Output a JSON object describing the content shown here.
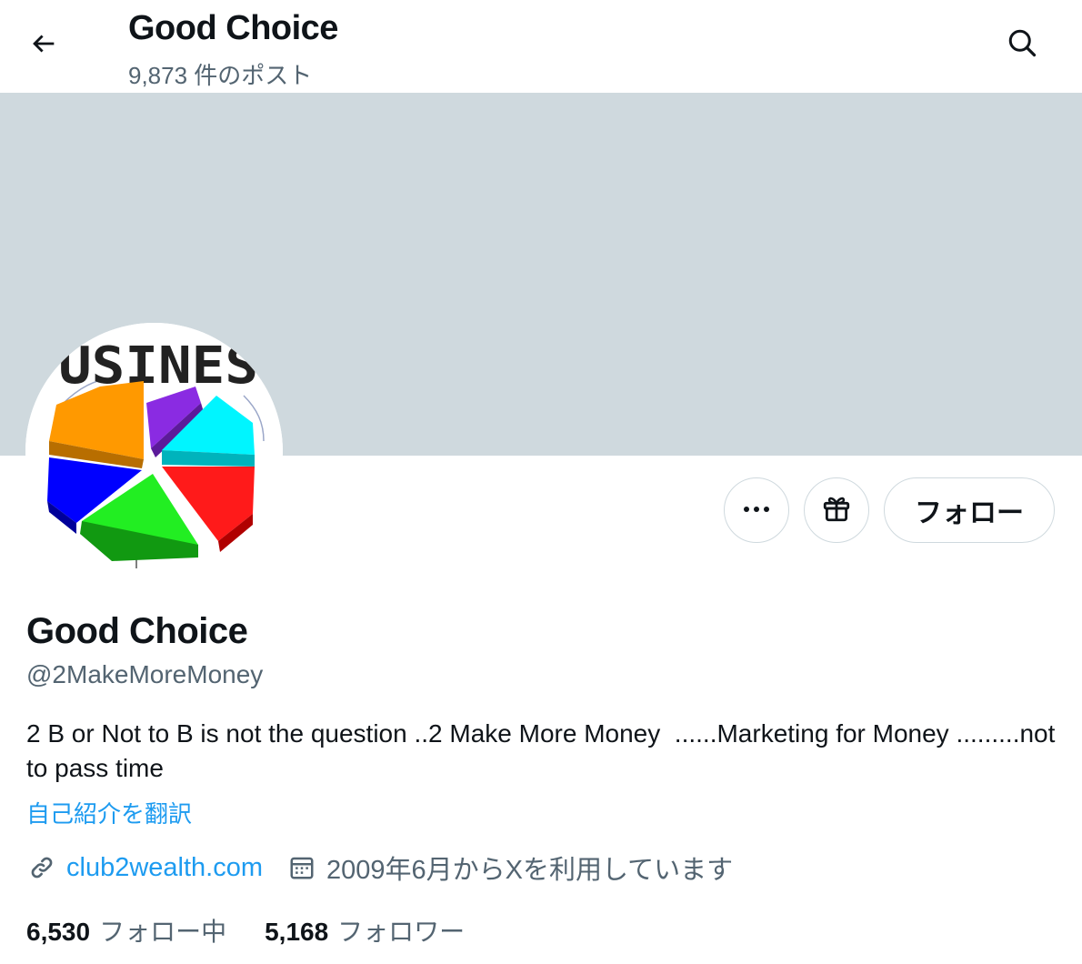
{
  "header": {
    "back_icon": "arrow-left-icon",
    "title": "Good Choice",
    "post_count": "9,873 件のポスト",
    "search_icon": "search-icon"
  },
  "banner": {
    "color": "#cfd9de"
  },
  "avatar": {
    "text": "USINES"
  },
  "actions": {
    "more_icon": "more-icon",
    "gift_icon": "gift-icon",
    "follow_label": "フォロー"
  },
  "profile": {
    "display_name": "Good Choice",
    "handle": "@2MakeMoreMoney",
    "bio": "2 B or Not to B is not the question ..2 Make More Money  ......Marketing for Money .........not to pass time",
    "translate_label": "自己紹介を翻訳",
    "link_icon": "link-icon",
    "website": "club2wealth.com",
    "calendar_icon": "calendar-icon",
    "joined": "2009年6月からXを利用しています"
  },
  "stats": {
    "following_count": "6,530",
    "following_label": "フォロー中",
    "followers_count": "5,168",
    "followers_label": "フォロワー"
  },
  "colors": {
    "accent": "#1d9bf0",
    "secondary_text": "#536471",
    "border": "#cfd9de"
  }
}
